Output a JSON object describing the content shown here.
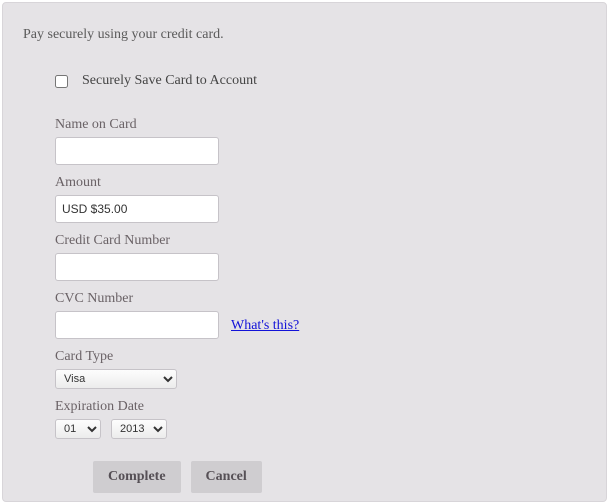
{
  "header": "Pay securely using your credit card.",
  "save_card": {
    "label": "Securely Save Card to Account",
    "checked": false
  },
  "fields": {
    "name_on_card": {
      "label": "Name on Card",
      "value": ""
    },
    "amount": {
      "label": "Amount",
      "value": "USD $35.00"
    },
    "cc_number": {
      "label": "Credit Card Number",
      "value": ""
    },
    "cvc": {
      "label": "CVC Number",
      "value": "",
      "hint_text": "What's this?"
    },
    "card_type": {
      "label": "Card Type",
      "selected": "Visa"
    },
    "expiration": {
      "label": "Expiration Date",
      "month": "01",
      "year": "2013"
    }
  },
  "buttons": {
    "complete": "Complete",
    "cancel": "Cancel"
  }
}
